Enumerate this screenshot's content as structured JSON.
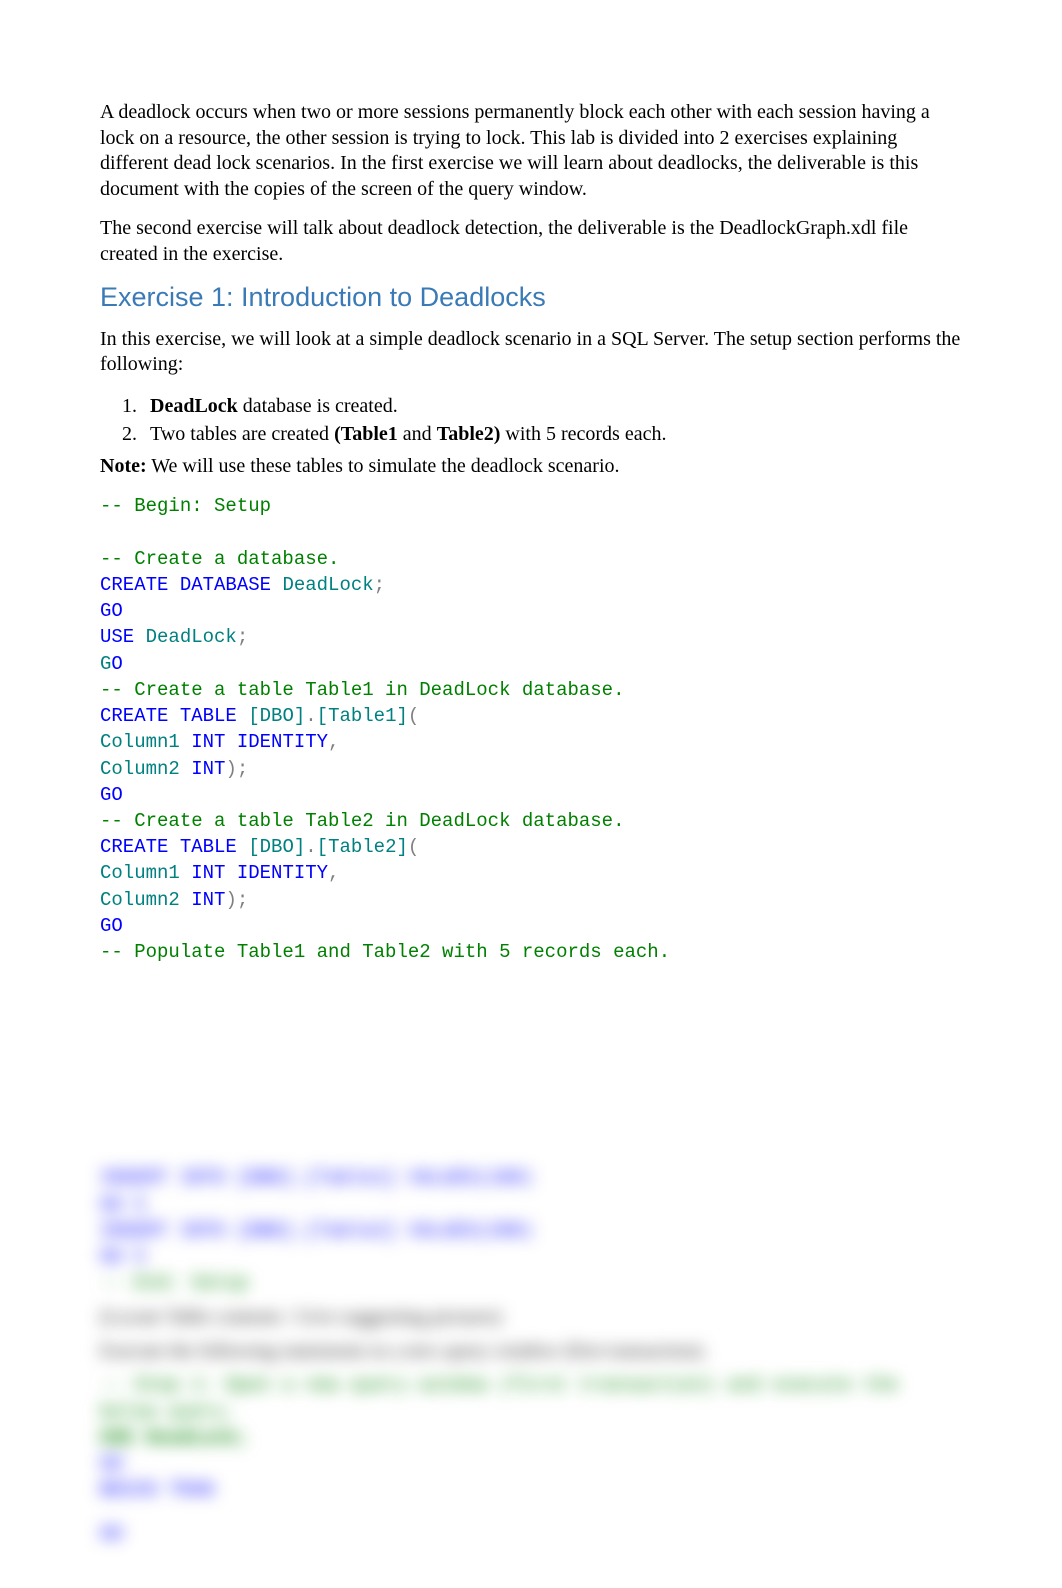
{
  "intro": {
    "p1": "A deadlock occurs when two or more sessions permanently block each other with each session having a lock on a resource, the other session is trying to lock. This lab is divided into 2 exercises explaining different dead lock scenarios. In the first exercise we will learn about deadlocks, the deliverable is this document with the copies of the screen of the query window.",
    "p2": "The second exercise will talk about deadlock detection, the deliverable is the DeadlockGraph.xdl file created in the exercise."
  },
  "exercise1": {
    "title": "Exercise 1: Introduction to Deadlocks",
    "intro": "In this exercise, we will look at a simple deadlock scenario in a SQL Server. The setup section performs the following:",
    "list": {
      "item1_bold": "DeadLock",
      "item1_rest": " database is created.",
      "item2_a": "Two tables are created ",
      "item2_b": "(Table1",
      "item2_c": " and ",
      "item2_d": "Table2)",
      "item2_e": " with 5 records each."
    },
    "note_label": "Note:",
    "note_text": " We will use these tables to simulate the deadlock scenario."
  },
  "code": {
    "l1": "-- Begin: Setup",
    "l3": "-- Create a database.",
    "l4a": "CREATE",
    "l4b": " DATABASE",
    "l4c": " DeadLock",
    "l4d": ";",
    "l5": "GO",
    "l6a": "USE",
    "l6b": " DeadLock",
    "l6c": ";",
    "l7a": "G",
    "l7b": "O",
    "l8": "-- Create a table Table1 in DeadLock database.",
    "l9a": "CREATE",
    "l9b": " TABLE",
    "l9c": " [DBO]",
    "l9d": ".",
    "l9e": "[Table1]",
    "l9f": "(",
    "l10a": "Column1 ",
    "l10b": "INT",
    "l10c": " IDENTITY",
    "l10d": ",",
    "l11a": "Column2 ",
    "l11b": "INT",
    "l11c": ");",
    "l12": "GO",
    "l13": "-- Create a table Table2 in DeadLock database.",
    "l14a": "CREATE",
    "l14b": " TABLE",
    "l14c": " [DBO]",
    "l14d": ".",
    "l14e": "[Table2]",
    "l14f": "(",
    "l15a": "Column1 ",
    "l15b": "INT",
    "l15c": " IDENTITY",
    "l15d": ",",
    "l16a": "Column2 ",
    "l16b": "INT",
    "l16c": ");",
    "l17": "GO",
    "l18": "-- Populate Table1 and Table2 with 5 records each."
  },
  "blur": {
    "c1": "INSERT INTO [DBO].[Table1] VALUES(100)",
    "c2": "GO 5",
    "c3": "INSERT INTO [DBO].[Table2] VALUES(200)",
    "c4": "GO 5",
    "c5": "-- End: Setup",
    "p1": "(Locate Table contents / Give suggesting pictures)",
    "p2": "Execute the following statements in a new query window (first transaction).",
    "c6": "-- Step 1: Open a new query window (first transaction) and execute the below query.",
    "c7": "USE DeadLock;",
    "c8": "GO",
    "c9": "BEGIN TRAN",
    "c10": "GO"
  }
}
